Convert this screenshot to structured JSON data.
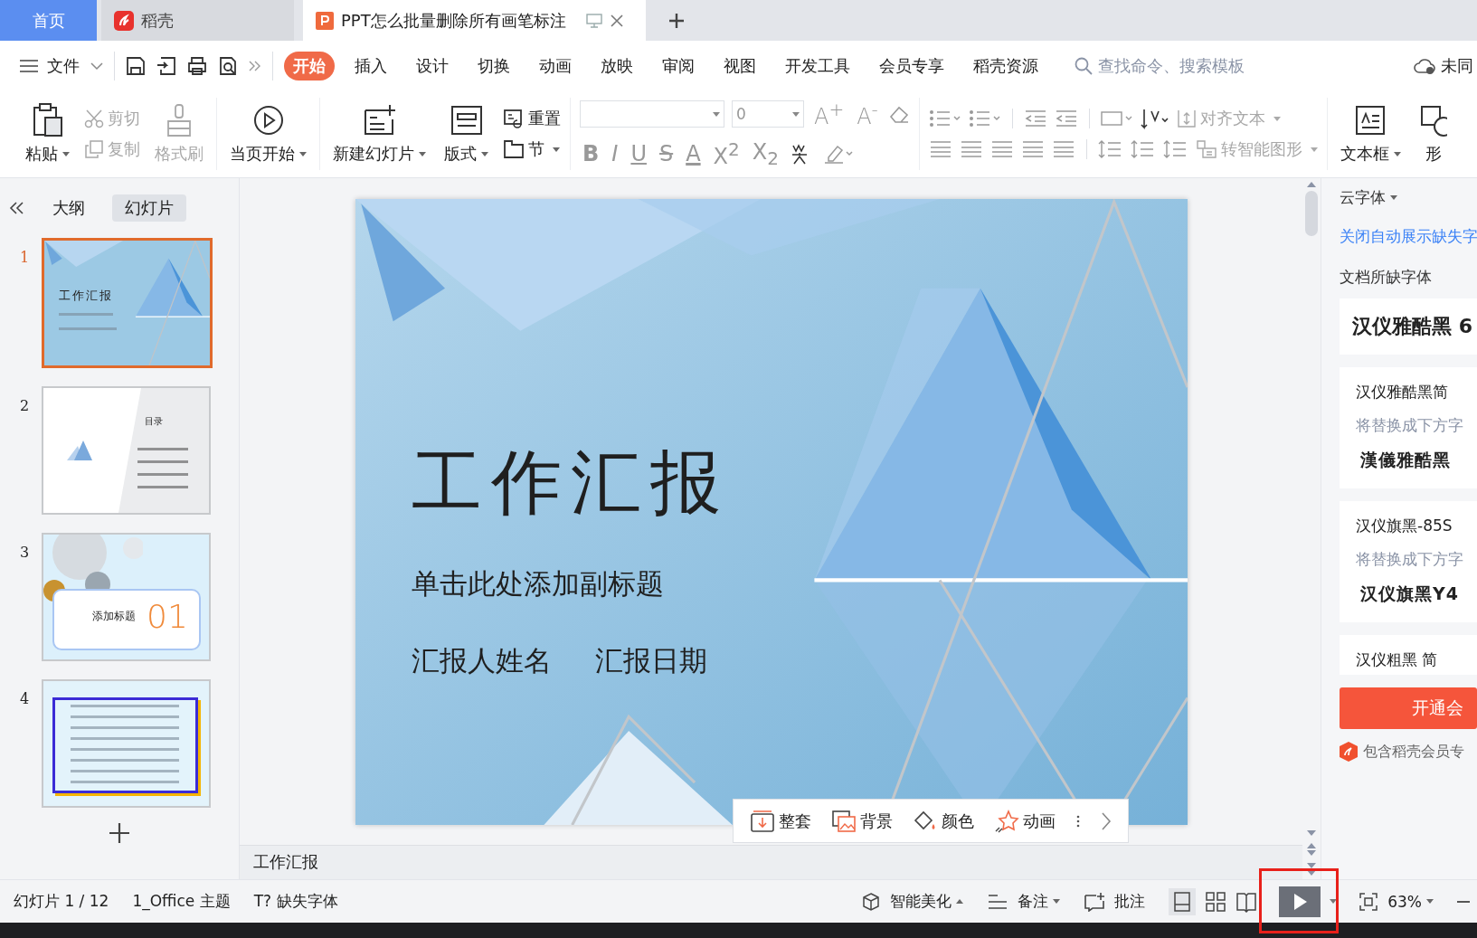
{
  "tabs": [
    {
      "label": "首页",
      "selected": false,
      "kind": "home"
    },
    {
      "label": "稻壳",
      "selected": false,
      "kind": "app"
    },
    {
      "label": "PPT怎么批量删除所有画笔标注",
      "selected": true,
      "kind": "doc"
    }
  ],
  "menu": {
    "file": "文件",
    "tabs": [
      {
        "label": "开始",
        "selected": true
      },
      {
        "label": "插入",
        "selected": false
      },
      {
        "label": "设计",
        "selected": false
      },
      {
        "label": "切换",
        "selected": false
      },
      {
        "label": "动画",
        "selected": false
      },
      {
        "label": "放映",
        "selected": false
      },
      {
        "label": "审阅",
        "selected": false
      },
      {
        "label": "视图",
        "selected": false
      },
      {
        "label": "开发工具",
        "selected": false
      },
      {
        "label": "会员专享",
        "selected": false
      },
      {
        "label": "稻壳资源",
        "selected": false
      }
    ],
    "search": {
      "placeholder": "查找命令、搜索模板"
    },
    "sync": "未同"
  },
  "ribbon": {
    "paste": "粘贴",
    "cut": {
      "label": "剪切",
      "disabled": true
    },
    "copy": {
      "label": "复制",
      "disabled": true
    },
    "format_painter": {
      "label": "格式刷",
      "disabled": true
    },
    "play_from_current": "当页开始",
    "new_slide": "新建幻灯片",
    "layout": "版式",
    "reset": "重置",
    "section": "节",
    "font_size": "0",
    "grow_font": "A$^{+}$",
    "shrink_font": "A$^{-}$",
    "format_buttons": [
      {
        "label": "B",
        "kind": "bold"
      },
      {
        "label": "I",
        "kind": "italic"
      },
      {
        "label": "U",
        "kind": "underline"
      },
      {
        "label": "S",
        "kind": "strike"
      },
      {
        "label": "A",
        "kind": "color"
      },
      {
        "label": "X$^{2}$",
        "kind": "plain"
      },
      {
        "label": "X$_{2}$",
        "kind": "plain"
      }
    ],
    "align_text": {
      "label": "对齐文本",
      "disabled": true
    },
    "smart_art": {
      "label": "转智能图形",
      "disabled": true
    },
    "text_box": "文本框",
    "shape": "形"
  },
  "outline_panel": {
    "tabs": [
      {
        "label": "大纲",
        "selected": false
      },
      {
        "label": "幻灯片",
        "selected": true
      }
    ],
    "slides": [
      {
        "number": "1",
        "selected": true,
        "kind": "title",
        "title": "工作汇报"
      },
      {
        "number": "2",
        "selected": false,
        "kind": "toc",
        "title": "目录"
      },
      {
        "number": "3",
        "selected": false,
        "kind": "section",
        "title": "添加标题",
        "index": "01"
      },
      {
        "number": "4",
        "selected": false,
        "kind": "text"
      }
    ]
  },
  "slide": {
    "title": "工作汇报",
    "subtitle": "单击此处添加副标题",
    "presenter": "汇报人姓名",
    "date": "汇报日期"
  },
  "slide_toolbar": [
    {
      "label": "整套"
    },
    {
      "label": "背景"
    },
    {
      "label": "颜色"
    },
    {
      "label": "动画"
    }
  ],
  "notes": "工作汇报",
  "fonts_panel": {
    "source": "云字体",
    "link": "关闭自动展示缺失字",
    "heading": "文档所缺字体",
    "missing": "汉仪雅酷黑 6",
    "cards": [
      {
        "name": "汉仪雅酷黑简",
        "hint": "将替换成下方字",
        "replacement": "漢儀雅酷黑"
      },
      {
        "name": "汉仪旗黑-85S",
        "hint": "将替换成下方字",
        "replacement": "汉仪旗黑Y4"
      },
      {
        "name": "汉仪粗黑 简"
      }
    ],
    "button": "开通会",
    "note": "包含稻壳会员专"
  },
  "status_bar": {
    "slide_count": "幻灯片 1 / 12",
    "theme": "1_Office 主题",
    "missing_font": "T? 缺失字体",
    "beautify": "智能美化",
    "notes": "备注",
    "comments": "批注",
    "zoom": "63%"
  }
}
